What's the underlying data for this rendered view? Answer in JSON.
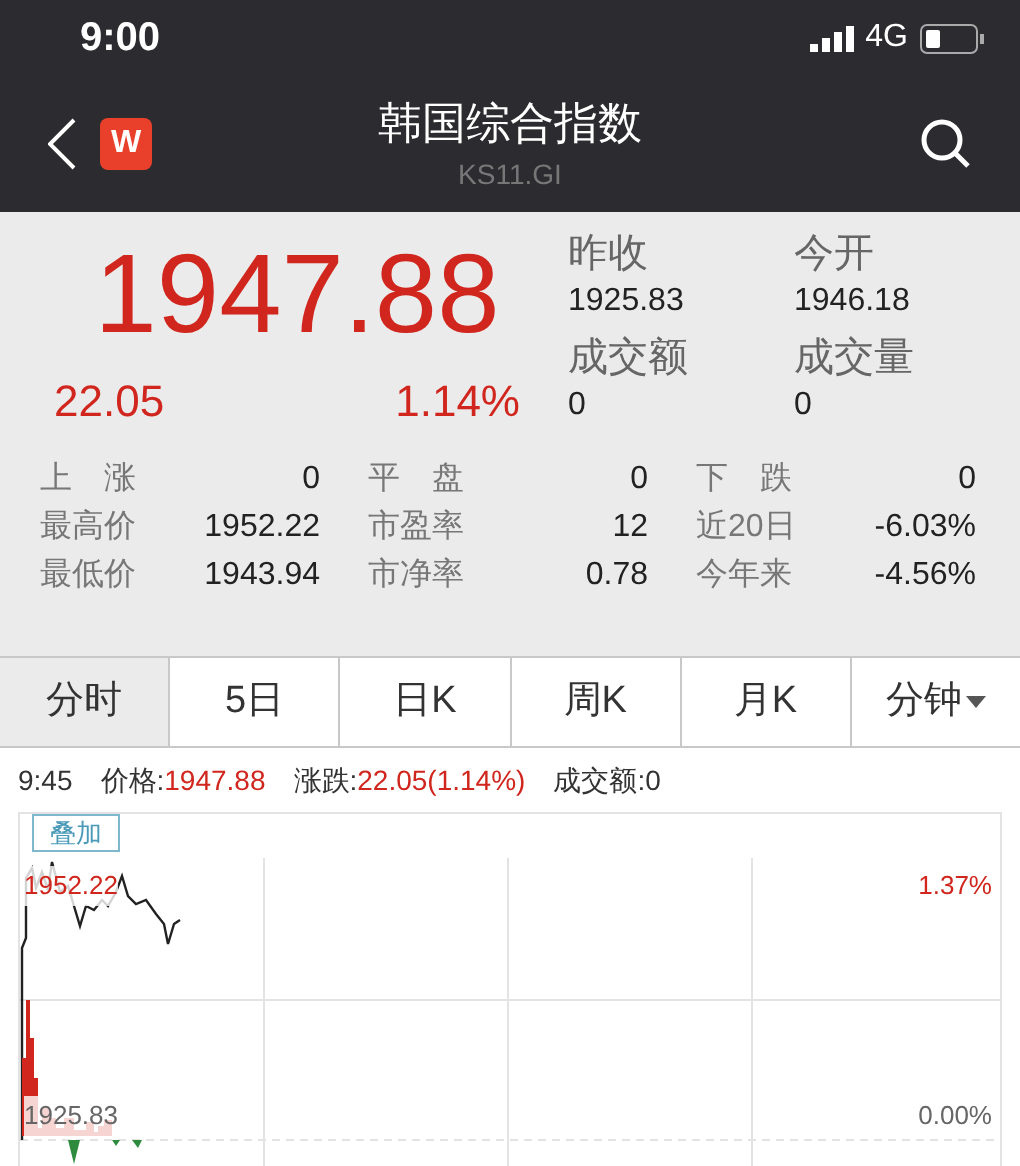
{
  "status_bar": {
    "time": "9:00",
    "network": "4G"
  },
  "header": {
    "title": "韩国综合指数",
    "code": "KS11.GI",
    "logo": "W"
  },
  "quote": {
    "price": "1947.88",
    "change": "22.05",
    "change_pct": "1.14%"
  },
  "summary": [
    {
      "label": "昨收",
      "value": "1925.83"
    },
    {
      "label": "今开",
      "value": "1946.18"
    },
    {
      "label": "成交额",
      "value": "0"
    },
    {
      "label": "成交量",
      "value": "0"
    }
  ],
  "stats": [
    {
      "label": "上　涨",
      "value": "0"
    },
    {
      "label": "平　盘",
      "value": "0"
    },
    {
      "label": "下　跌",
      "value": "0"
    },
    {
      "label": "最高价",
      "value": "1952.22"
    },
    {
      "label": "市盈率",
      "value": "12"
    },
    {
      "label": "近20日",
      "value": "-6.03%"
    },
    {
      "label": "最低价",
      "value": "1943.94"
    },
    {
      "label": "市净率",
      "value": "0.78"
    },
    {
      "label": "今年来",
      "value": "-4.56%"
    }
  ],
  "tabs": [
    {
      "label": "分时",
      "selected": true,
      "kind": "plain"
    },
    {
      "label": "5日",
      "selected": false,
      "kind": "plain"
    },
    {
      "label": "日K",
      "selected": false,
      "kind": "plain"
    },
    {
      "label": "周K",
      "selected": false,
      "kind": "plain"
    },
    {
      "label": "月K",
      "selected": false,
      "kind": "plain"
    },
    {
      "label": "分钟",
      "selected": false,
      "kind": "dropdown"
    }
  ],
  "info_line": {
    "time": "9:45",
    "price_label": "价格:",
    "price": "1947.88",
    "change_label": "涨跌:",
    "change": "22.05(1.14%)",
    "amount_label": "成交额:",
    "amount": "0"
  },
  "chart": {
    "overlay_button": "叠加",
    "high_label": "1952.22",
    "high_pct": "1.37%",
    "base_label": "1925.83",
    "base_pct": "0.00%"
  }
}
